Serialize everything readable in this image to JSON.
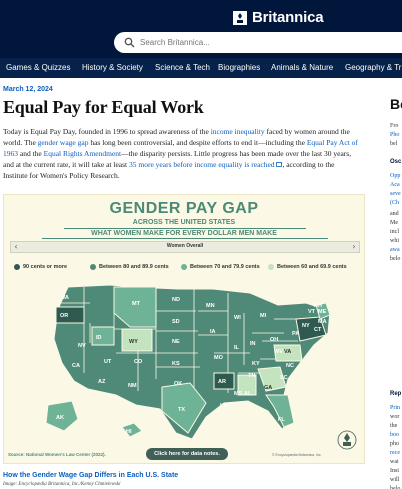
{
  "site": {
    "brand": "Britannica"
  },
  "search": {
    "placeholder": "Search Britannica..."
  },
  "nav": [
    "Games & Quizzes",
    "History & Society",
    "Science & Tech",
    "Biographies",
    "Animals & Nature",
    "Geography & Tr"
  ],
  "article": {
    "date": "March 12, 2024",
    "title": "Equal Pay for Equal Work",
    "p": {
      "t1": "Today is Equal Pay Day, founded in 1996 to spread awareness of the ",
      "l1": "income inequality",
      "t2": " faced by women around the world. The ",
      "l2": "gender wage gap",
      "t3": " has long been controversial, and despite efforts to end it—including the ",
      "l3": "Equal Pay Act of 1963",
      "t4": " and the ",
      "l4": "Equal Rights Amendment",
      "t5": "—the disparity persists. Little progress has been made over the last 30 years, and at the current rate, it will take at least ",
      "l5": "35 more years before income equality is reached",
      "t6": ", according to the Institute for Women's Policy Research."
    }
  },
  "infographic": {
    "title": "GENDER PAY GAP",
    "subtitle": "ACROSS THE UNITED STATES",
    "subtitle2": "WHAT WOMEN MAKE FOR EVERY DOLLAR MEN MAKE",
    "selector": "Women Overall",
    "legend": [
      {
        "label": "90 cents or more",
        "color": "#2f5a4f"
      },
      {
        "label": "Between 80 and 89.9 cents",
        "color": "#4f8a78"
      },
      {
        "label": "Between 70 and 79.9 cents",
        "color": "#6eb396"
      },
      {
        "label": "Between 60 and 69.9 cents",
        "color": "#c4e3bf"
      }
    ],
    "states": [
      "WA",
      "OR",
      "CA",
      "ID",
      "NV",
      "MT",
      "WY",
      "UT",
      "AZ",
      "CO",
      "NM",
      "ND",
      "SD",
      "NE",
      "KS",
      "OK",
      "TX",
      "MN",
      "IA",
      "MO",
      "AR",
      "LA",
      "WI",
      "IL",
      "MS",
      "MI",
      "IN",
      "KY",
      "TN",
      "AL",
      "OH",
      "GA",
      "FL",
      "WV",
      "SC",
      "NC",
      "VA",
      "PA",
      "NY",
      "VT",
      "NH",
      "ME",
      "MA",
      "CT",
      "AK",
      "HI"
    ],
    "source": "Source: National Women's Law Center (2022).",
    "copyright": "© Encyclopædia Britannica, Inc.",
    "button": "Click here for data notes."
  },
  "caption": {
    "link": "How the Gender Wage Gap Differs in Each U.S. State",
    "credit": "Image: Encyclopædia Britannica, Inc./Kenny Chmielewski"
  },
  "sidebar": {
    "heading": "Be",
    "lines": [
      "Fro",
      "Pho",
      "bel"
    ],
    "sub": "Osc",
    "links": [
      "Opp",
      "Aca",
      "seve",
      "(Ch"
    ],
    "more": [
      "and",
      "Me",
      "incl",
      "whi",
      "awa",
      "belo"
    ],
    "sub2": "Rep",
    "links2": [
      "Prin"
    ],
    "more2": [
      "wor",
      "the"
    ],
    "links3": [
      "boo"
    ],
    "more3": [
      "pho"
    ],
    "links4": [
      "rece"
    ],
    "more4": [
      "wai",
      "Inst",
      "will",
      "belo"
    ]
  },
  "colors": {
    "header": "#00163a",
    "nav": "#06224a",
    "link": "#0c5ec2",
    "accent": "#4b8a76"
  }
}
